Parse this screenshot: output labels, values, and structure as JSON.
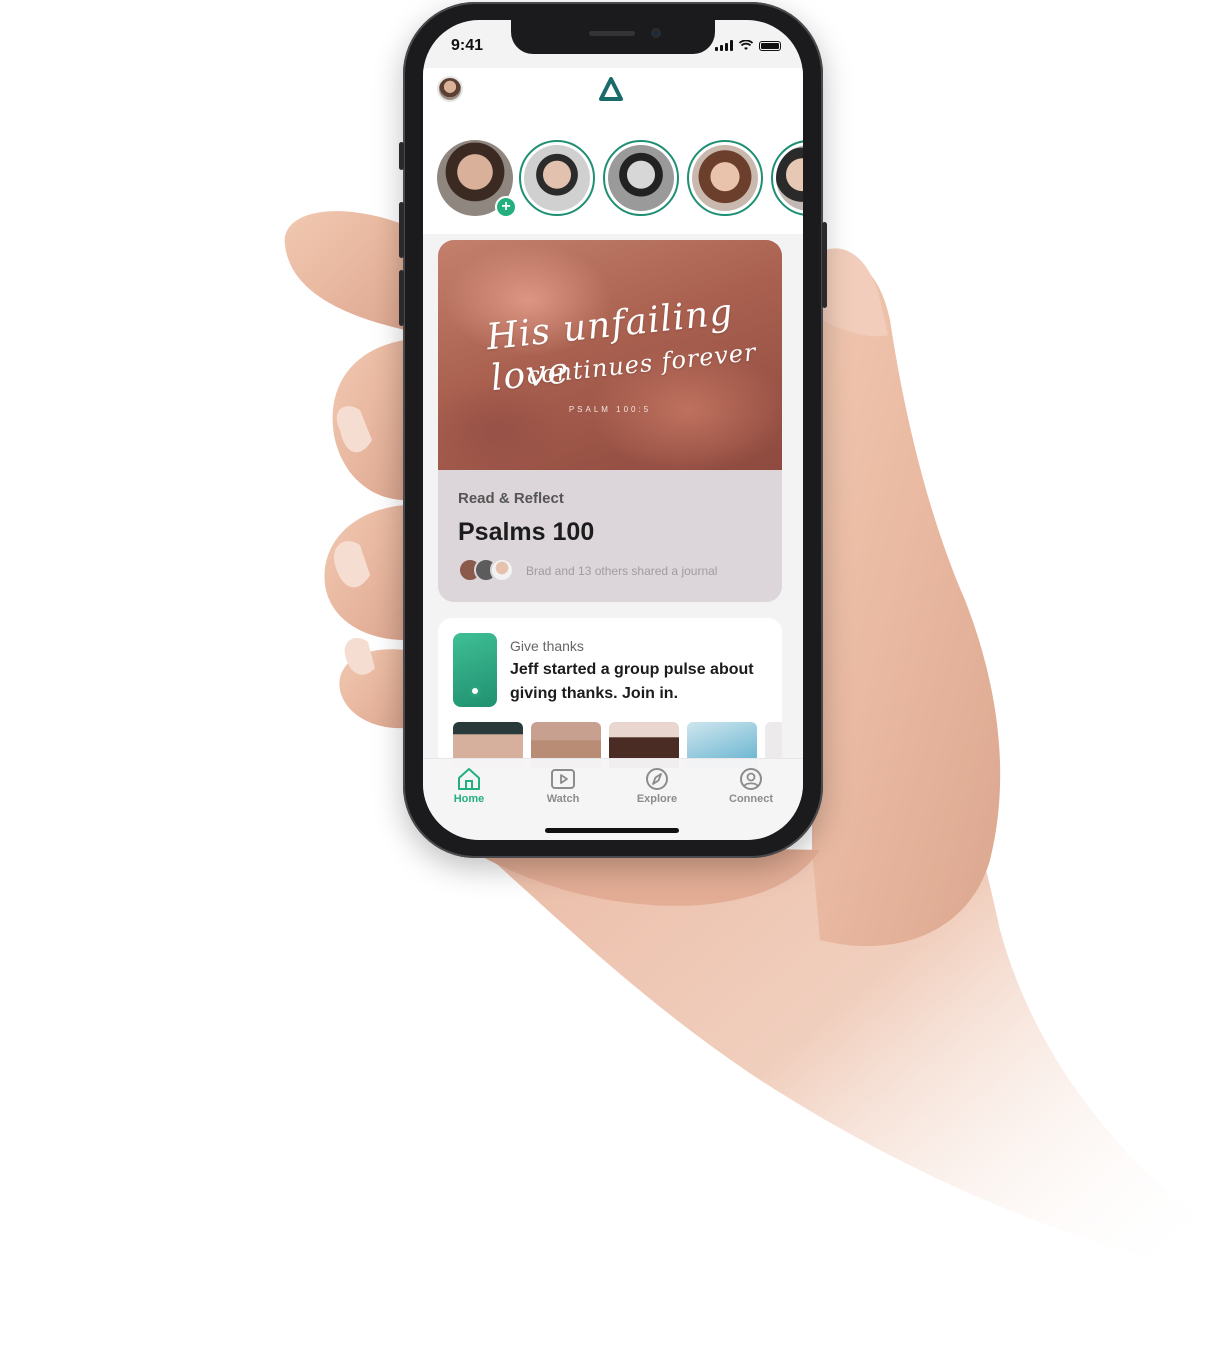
{
  "status_bar": {
    "time": "9:41"
  },
  "header": {
    "profile_icon": "user-avatar",
    "logo_icon": "triangle-logo"
  },
  "stories": [
    {
      "icon": "story-avatar-add",
      "has_add_badge": true
    },
    {
      "icon": "story-avatar"
    },
    {
      "icon": "story-avatar"
    },
    {
      "icon": "story-avatar"
    },
    {
      "icon": "story-avatar-partial"
    }
  ],
  "add_badge": "+",
  "featured_card": {
    "image_text_line1": "His unfailing love",
    "image_text_line2": "continues forever",
    "image_reference": "PSALM 100:5",
    "kicker": "Read & Reflect",
    "title": "Psalms 100",
    "meta": "Brad and 13 others shared a journal"
  },
  "pulse_card": {
    "kicker": "Give thanks",
    "text": "Jeff started a group pulse about giving thanks. Join in."
  },
  "tabs": [
    {
      "label": "Home",
      "icon": "home-icon",
      "active": true
    },
    {
      "label": "Watch",
      "icon": "play-icon",
      "active": false
    },
    {
      "label": "Explore",
      "icon": "compass-icon",
      "active": false
    },
    {
      "label": "Connect",
      "icon": "user-circle-icon",
      "active": false
    }
  ],
  "colors": {
    "accent": "#23b07e",
    "ring": "#1f8f73",
    "logo": "#1a6b6b"
  }
}
